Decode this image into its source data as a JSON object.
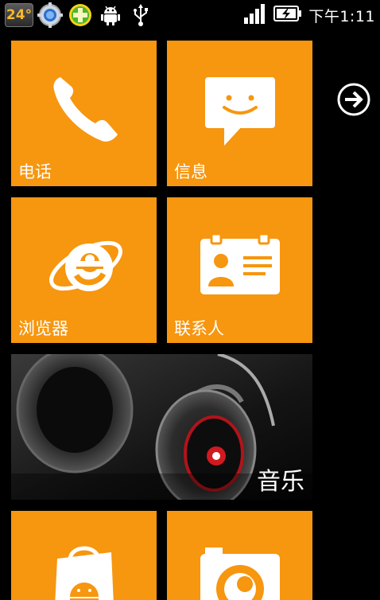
{
  "status_bar": {
    "temperature": "24°",
    "time": "下午1:11"
  },
  "tiles": {
    "phone": {
      "label": "电话",
      "icon": "phone-icon"
    },
    "messages": {
      "label": "信息",
      "icon": "message-icon"
    },
    "browser": {
      "label": "浏览器",
      "icon": "ie-icon"
    },
    "contacts": {
      "label": "联系人",
      "icon": "contact-card-icon"
    },
    "music": {
      "label": "音乐",
      "icon": "headphones-image"
    },
    "store": {
      "label": "",
      "icon": "shopping-bag-icon"
    },
    "camera": {
      "label": "",
      "icon": "camera-icon"
    }
  },
  "colors": {
    "tile_accent": "#f7960f",
    "background": "#000000"
  }
}
